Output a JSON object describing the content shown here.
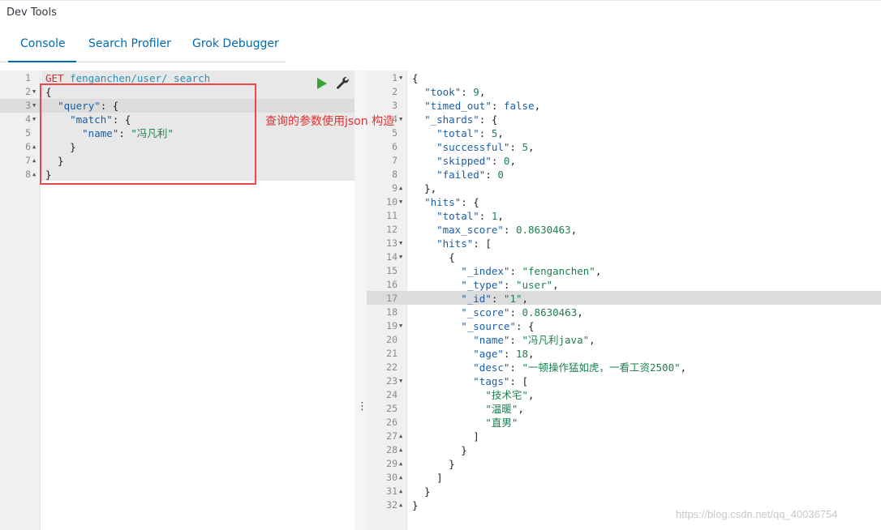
{
  "app": {
    "title": "Dev Tools"
  },
  "tabs": [
    {
      "label": "Console",
      "active": true
    },
    {
      "label": "Search Profiler",
      "active": false
    },
    {
      "label": "Grok Debugger",
      "active": false
    }
  ],
  "request_editor": {
    "lines": [
      {
        "n": "1",
        "fold": "",
        "tokens": [
          [
            "method",
            "GET"
          ],
          [
            "punct",
            " "
          ],
          [
            "url",
            "fenganchen/user/_search"
          ]
        ]
      },
      {
        "n": "2",
        "fold": "▼",
        "tokens": [
          [
            "punct",
            "{"
          ]
        ]
      },
      {
        "n": "3",
        "fold": "▼",
        "tokens": [
          [
            "punct",
            "  "
          ],
          [
            "key",
            "\"query\""
          ],
          [
            "punct",
            ": {"
          ]
        ]
      },
      {
        "n": "4",
        "fold": "▼",
        "tokens": [
          [
            "punct",
            "    "
          ],
          [
            "key",
            "\"match\""
          ],
          [
            "punct",
            ": {"
          ]
        ]
      },
      {
        "n": "5",
        "fold": "",
        "tokens": [
          [
            "punct",
            "      "
          ],
          [
            "key",
            "\"name\""
          ],
          [
            "punct",
            ": "
          ],
          [
            "str",
            "\"冯凡利\""
          ]
        ]
      },
      {
        "n": "6",
        "fold": "▲",
        "tokens": [
          [
            "punct",
            "    }"
          ]
        ]
      },
      {
        "n": "7",
        "fold": "▲",
        "tokens": [
          [
            "punct",
            "  }"
          ]
        ]
      },
      {
        "n": "8",
        "fold": "▲",
        "tokens": [
          [
            "punct",
            "}"
          ]
        ]
      }
    ],
    "run_icon": "play-icon",
    "settings_icon": "wrench-icon"
  },
  "annotation": {
    "text": "查询的参数使用json 构造",
    "color": "#e03131"
  },
  "response_viewer": {
    "lines": [
      {
        "n": "1",
        "fold": "▼",
        "tokens": [
          [
            "punct",
            "{"
          ]
        ]
      },
      {
        "n": "2",
        "fold": "",
        "tokens": [
          [
            "punct",
            "  "
          ],
          [
            "key",
            "\"took\""
          ],
          [
            "punct",
            ": "
          ],
          [
            "num",
            "9"
          ],
          [
            "punct",
            ","
          ]
        ]
      },
      {
        "n": "3",
        "fold": "",
        "tokens": [
          [
            "punct",
            "  "
          ],
          [
            "key",
            "\"timed_out\""
          ],
          [
            "punct",
            ": "
          ],
          [
            "bool",
            "false"
          ],
          [
            "punct",
            ","
          ]
        ]
      },
      {
        "n": "4",
        "fold": "▼",
        "tokens": [
          [
            "punct",
            "  "
          ],
          [
            "key",
            "\"_shards\""
          ],
          [
            "punct",
            ": {"
          ]
        ]
      },
      {
        "n": "5",
        "fold": "",
        "tokens": [
          [
            "punct",
            "    "
          ],
          [
            "key",
            "\"total\""
          ],
          [
            "punct",
            ": "
          ],
          [
            "num",
            "5"
          ],
          [
            "punct",
            ","
          ]
        ]
      },
      {
        "n": "6",
        "fold": "",
        "tokens": [
          [
            "punct",
            "    "
          ],
          [
            "key",
            "\"successful\""
          ],
          [
            "punct",
            ": "
          ],
          [
            "num",
            "5"
          ],
          [
            "punct",
            ","
          ]
        ]
      },
      {
        "n": "7",
        "fold": "",
        "tokens": [
          [
            "punct",
            "    "
          ],
          [
            "key",
            "\"skipped\""
          ],
          [
            "punct",
            ": "
          ],
          [
            "num",
            "0"
          ],
          [
            "punct",
            ","
          ]
        ]
      },
      {
        "n": "8",
        "fold": "",
        "tokens": [
          [
            "punct",
            "    "
          ],
          [
            "key",
            "\"failed\""
          ],
          [
            "punct",
            ": "
          ],
          [
            "num",
            "0"
          ]
        ]
      },
      {
        "n": "9",
        "fold": "▲",
        "tokens": [
          [
            "punct",
            "  },"
          ]
        ]
      },
      {
        "n": "10",
        "fold": "▼",
        "tokens": [
          [
            "punct",
            "  "
          ],
          [
            "key",
            "\"hits\""
          ],
          [
            "punct",
            ": {"
          ]
        ]
      },
      {
        "n": "11",
        "fold": "",
        "tokens": [
          [
            "punct",
            "    "
          ],
          [
            "key",
            "\"total\""
          ],
          [
            "punct",
            ": "
          ],
          [
            "num",
            "1"
          ],
          [
            "punct",
            ","
          ]
        ]
      },
      {
        "n": "12",
        "fold": "",
        "tokens": [
          [
            "punct",
            "    "
          ],
          [
            "key",
            "\"max_score\""
          ],
          [
            "punct",
            ": "
          ],
          [
            "num",
            "0.8630463"
          ],
          [
            "punct",
            ","
          ]
        ]
      },
      {
        "n": "13",
        "fold": "▼",
        "tokens": [
          [
            "punct",
            "    "
          ],
          [
            "key",
            "\"hits\""
          ],
          [
            "punct",
            ": ["
          ]
        ]
      },
      {
        "n": "14",
        "fold": "▼",
        "tokens": [
          [
            "punct",
            "      {"
          ]
        ]
      },
      {
        "n": "15",
        "fold": "",
        "tokens": [
          [
            "punct",
            "        "
          ],
          [
            "key",
            "\"_index\""
          ],
          [
            "punct",
            ": "
          ],
          [
            "str",
            "\"fenganchen\""
          ],
          [
            "punct",
            ","
          ]
        ]
      },
      {
        "n": "16",
        "fold": "",
        "tokens": [
          [
            "punct",
            "        "
          ],
          [
            "key",
            "\"_type\""
          ],
          [
            "punct",
            ": "
          ],
          [
            "str",
            "\"user\""
          ],
          [
            "punct",
            ","
          ]
        ]
      },
      {
        "n": "17",
        "fold": "",
        "tokens": [
          [
            "punct",
            "        "
          ],
          [
            "key",
            "\"_id\""
          ],
          [
            "punct",
            ": "
          ],
          [
            "str",
            "\"1\""
          ],
          [
            "punct",
            ","
          ]
        ]
      },
      {
        "n": "18",
        "fold": "",
        "tokens": [
          [
            "punct",
            "        "
          ],
          [
            "key",
            "\"_score\""
          ],
          [
            "punct",
            ": "
          ],
          [
            "num",
            "0.8630463"
          ],
          [
            "punct",
            ","
          ]
        ]
      },
      {
        "n": "19",
        "fold": "▼",
        "tokens": [
          [
            "punct",
            "        "
          ],
          [
            "key",
            "\"_source\""
          ],
          [
            "punct",
            ": {"
          ]
        ]
      },
      {
        "n": "20",
        "fold": "",
        "tokens": [
          [
            "punct",
            "          "
          ],
          [
            "key",
            "\"name\""
          ],
          [
            "punct",
            ": "
          ],
          [
            "str",
            "\"冯凡利java\""
          ],
          [
            "punct",
            ","
          ]
        ]
      },
      {
        "n": "21",
        "fold": "",
        "tokens": [
          [
            "punct",
            "          "
          ],
          [
            "key",
            "\"age\""
          ],
          [
            "punct",
            ": "
          ],
          [
            "num",
            "18"
          ],
          [
            "punct",
            ","
          ]
        ]
      },
      {
        "n": "22",
        "fold": "",
        "tokens": [
          [
            "punct",
            "          "
          ],
          [
            "key",
            "\"desc\""
          ],
          [
            "punct",
            ": "
          ],
          [
            "str",
            "\"一顿操作猛如虎，一看工资2500\""
          ],
          [
            "punct",
            ","
          ]
        ]
      },
      {
        "n": "23",
        "fold": "▼",
        "tokens": [
          [
            "punct",
            "          "
          ],
          [
            "key",
            "\"tags\""
          ],
          [
            "punct",
            ": ["
          ]
        ]
      },
      {
        "n": "24",
        "fold": "",
        "tokens": [
          [
            "punct",
            "            "
          ],
          [
            "str",
            "\"技术宅\""
          ],
          [
            "punct",
            ","
          ]
        ]
      },
      {
        "n": "25",
        "fold": "",
        "tokens": [
          [
            "punct",
            "            "
          ],
          [
            "str",
            "\"温暖\""
          ],
          [
            "punct",
            ","
          ]
        ]
      },
      {
        "n": "26",
        "fold": "",
        "tokens": [
          [
            "punct",
            "            "
          ],
          [
            "str",
            "\"直男\""
          ]
        ]
      },
      {
        "n": "27",
        "fold": "▲",
        "tokens": [
          [
            "punct",
            "          ]"
          ]
        ]
      },
      {
        "n": "28",
        "fold": "▲",
        "tokens": [
          [
            "punct",
            "        }"
          ]
        ]
      },
      {
        "n": "29",
        "fold": "▲",
        "tokens": [
          [
            "punct",
            "      }"
          ]
        ]
      },
      {
        "n": "30",
        "fold": "▲",
        "tokens": [
          [
            "punct",
            "    ]"
          ]
        ]
      },
      {
        "n": "31",
        "fold": "▲",
        "tokens": [
          [
            "punct",
            "  }"
          ]
        ]
      },
      {
        "n": "32",
        "fold": "▲",
        "tokens": [
          [
            "punct",
            "}"
          ]
        ]
      }
    ]
  },
  "divider_icon": "vertical-dots-icon",
  "divider_glyph": "⋮",
  "watermark": "https://blog.csdn.net/qq_40036754"
}
